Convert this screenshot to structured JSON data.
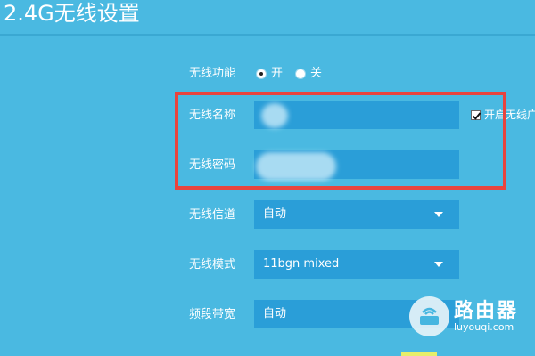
{
  "page": {
    "title": "2.4G无线设置"
  },
  "wireless_function": {
    "label": "无线功能",
    "options": [
      {
        "label": "开",
        "checked": true
      },
      {
        "label": "关",
        "checked": false
      }
    ]
  },
  "ssid": {
    "label": "无线名称",
    "value": ""
  },
  "broadcast_checkbox": {
    "label": "开启无线广播",
    "checked": true
  },
  "password": {
    "label": "无线密码",
    "value": ""
  },
  "channel": {
    "label": "无线信道",
    "value": "自动"
  },
  "mode": {
    "label": "无线模式",
    "value": "11bgn mixed"
  },
  "bandwidth": {
    "label": "频段带宽",
    "value": "自动"
  },
  "watermark": {
    "main": "路由器",
    "sub": "luyouqi.com"
  },
  "colors": {
    "background": "#4ab9e1",
    "field": "#2a9ed8",
    "highlight": "#e8443e"
  }
}
